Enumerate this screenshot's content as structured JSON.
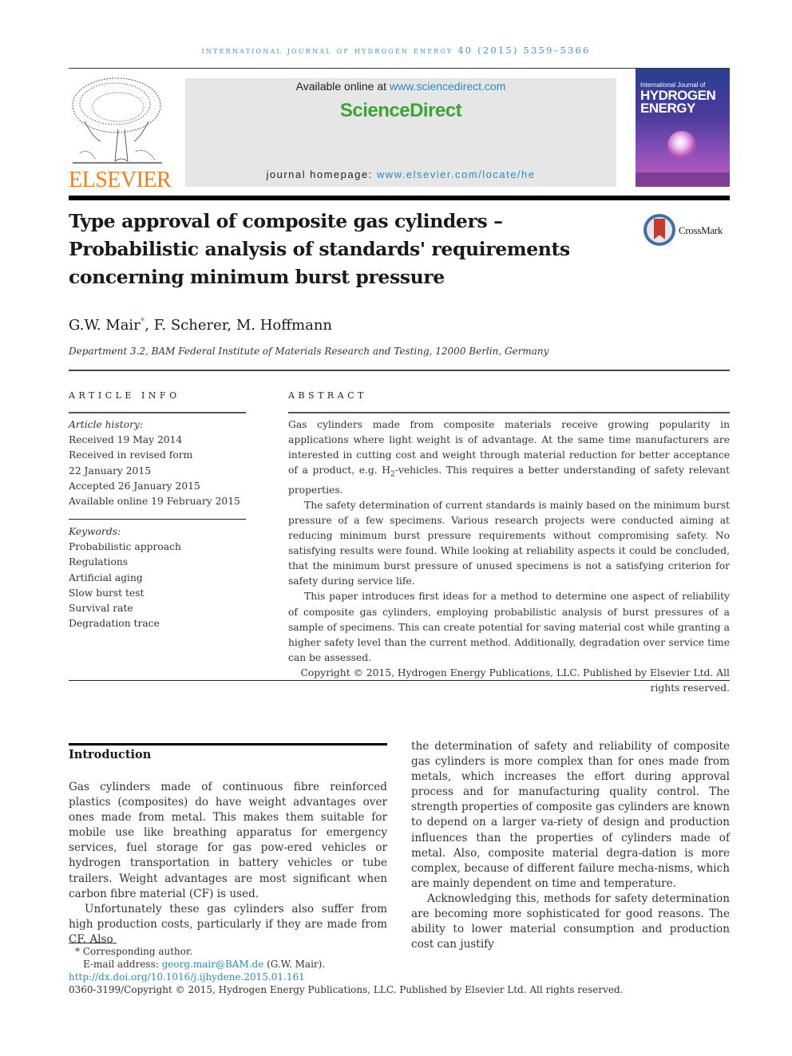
{
  "header": {
    "journal_citation": "International Journal of Hydrogen Energy 40 (2015) 5359–5366",
    "publisher_logo_text": "ELSEVIER",
    "available_online_prefix": "Available online at ",
    "available_online_link": "www.sciencedirect.com",
    "brand": "ScienceDirect",
    "homepage_prefix": "journal homepage: ",
    "homepage_link": "www.elsevier.com/locate/he",
    "cover": {
      "line1": "International Journal of",
      "line2": "HYDROGEN",
      "line3": "ENERGY"
    },
    "crossmark_label": "CrossMark"
  },
  "article": {
    "title_lines": [
      "Type approval of composite gas cylinders –",
      "Probabilistic analysis of standards' requirements",
      "concerning minimum burst pressure"
    ],
    "authors": {
      "first": "G.W. Mair",
      "first_marker": "*",
      "rest": ", F. Scherer, M. Hoffmann"
    },
    "affiliation": "Department 3.2, BAM Federal Institute of Materials Research and Testing, 12000 Berlin, Germany"
  },
  "article_info": {
    "label": "Article info",
    "history_label": "Article history:",
    "history": [
      "Received 19 May 2014",
      "Received in revised form",
      "22 January 2015",
      "Accepted 26 January 2015",
      "Available online 19 February 2015"
    ],
    "keywords_label": "Keywords:",
    "keywords": [
      "Probabilistic approach",
      "Regulations",
      "Artificial aging",
      "Slow burst test",
      "Survival rate",
      "Degradation trace"
    ]
  },
  "abstract": {
    "label": "Abstract",
    "p1_a": "Gas cylinders made from composite materials receive growing popularity in applications where light weight is of advantage. At the same time manufacturers are interested in cutting cost and weight through material reduction for better acceptance of a product, e.g. H",
    "p1_sub": "2",
    "p1_b": "-vehicles. This requires a better understanding of safety relevant properties.",
    "p2": "The safety determination of current standards is mainly based on the minimum burst pressure of a few specimens. Various research projects were conducted aiming at reducing minimum burst pressure requirements without compromising safety. No satisfying results were found. While looking at reliability aspects it could be concluded, that the minimum burst pressure of unused specimens is not a satisfying criterion for safety during service life.",
    "p3": "This paper introduces first ideas for a method to determine one aspect of reliability of composite gas cylinders, employing probabilistic analysis of burst pressures of a sample of specimens. This can create potential for saving material cost while granting a higher safety level than the current method. Additionally, degradation over service time can be assessed.",
    "copyright": "Copyright © 2015, Hydrogen Energy Publications, LLC. Published by Elsevier Ltd. All rights reserved."
  },
  "introduction": {
    "heading": "Introduction",
    "left_p1": "Gas cylinders made of continuous fibre reinforced plastics (composites) do have weight advantages over ones made from metal. This makes them suitable for mobile use like breathing apparatus for emergency services, fuel storage for gas pow-ered vehicles or hydrogen transportation in battery vehicles or tube trailers. Weight advantages are most significant when carbon fibre material (CF) is used.",
    "left_p2": "Unfortunately these gas cylinders also suffer from high production costs, particularly if they are made from CF. Also",
    "right_p1": "the determination of safety and reliability of composite gas cylinders is more complex than for ones made from metals, which increases the effort during approval process and for manufacturing quality control. The strength properties of composite gas cylinders are known to depend on a larger va-riety of design and production influences than the properties of cylinders made of metal. Also, composite material degra-dation is more complex, because of different failure mecha-nisms, which are mainly dependent on time and temperature.",
    "right_p2": "Acknowledging this, methods for safety determination are becoming more sophisticated for good reasons. The ability to lower material consumption and production cost can justify"
  },
  "footnotes": {
    "corresponding": "* Corresponding author.",
    "email_prefix": "E-mail address: ",
    "email": "georg.mair@BAM.de",
    "email_suffix": " (G.W. Mair).",
    "doi": "http://dx.doi.org/10.1016/j.ijhydene.2015.01.161",
    "issn_copyright": "0360-3199/Copyright © 2015, Hydrogen Energy Publications, LLC. Published by Elsevier Ltd. All rights reserved."
  },
  "colors": {
    "link": "#2a8bc0",
    "brand_green": "#3aa535",
    "elsevier_orange": "#f07f1a",
    "journal_header": "#3a9bbf"
  }
}
